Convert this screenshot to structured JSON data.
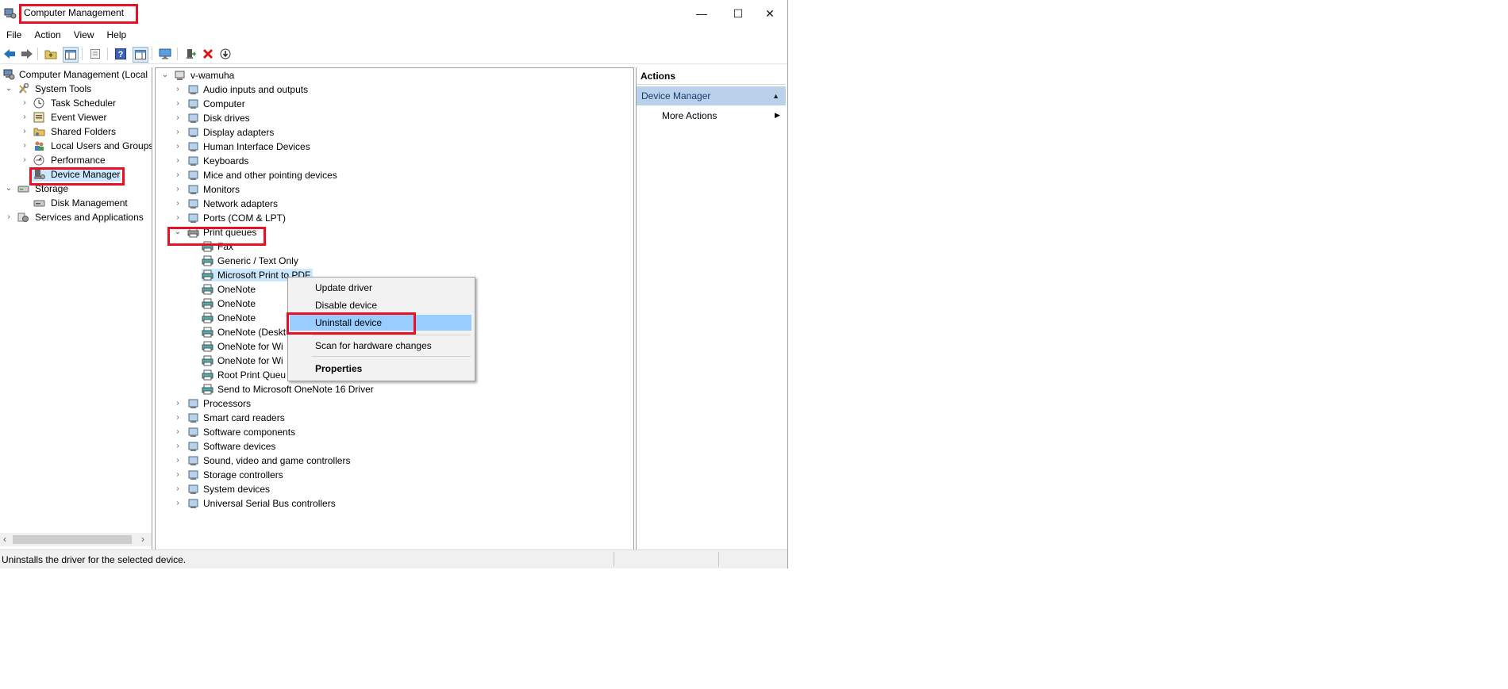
{
  "window": {
    "title": "Computer Management",
    "controls": {
      "minimize": "—",
      "maximize": "☐",
      "close": "✕"
    }
  },
  "menubar": [
    "File",
    "Action",
    "View",
    "Help"
  ],
  "toolbar": {
    "icons": [
      "back-icon",
      "forward-icon",
      "up-folder-icon",
      "show-hide-tree-icon",
      "properties-icon",
      "help-icon",
      "show-hide-action-pane-icon",
      "monitor-icon",
      "update-driver-icon",
      "uninstall-icon",
      "scan-hardware-icon"
    ]
  },
  "left_tree": {
    "root": "Computer Management (Local",
    "items": [
      {
        "label": "System Tools",
        "expander": "⌄"
      },
      {
        "label": "Task Scheduler",
        "expander": "›"
      },
      {
        "label": "Event Viewer",
        "expander": "›"
      },
      {
        "label": "Shared Folders",
        "expander": "›"
      },
      {
        "label": "Local Users and Groups",
        "expander": "›"
      },
      {
        "label": "Performance",
        "expander": "›"
      },
      {
        "label": "Device Manager",
        "expander": ""
      },
      {
        "label": "Storage",
        "expander": "⌄"
      },
      {
        "label": "Disk Management",
        "expander": ""
      },
      {
        "label": "Services and Applications",
        "expander": "›"
      }
    ],
    "scroll_left": "‹",
    "scroll_right": "›"
  },
  "device_tree": {
    "root": "v-wamuha",
    "categories_before": [
      "Audio inputs and outputs",
      "Computer",
      "Disk drives",
      "Display adapters",
      "Human Interface Devices",
      "Keyboards",
      "Mice and other pointing devices",
      "Monitors",
      "Network adapters",
      "Ports (COM & LPT)"
    ],
    "expanded_category": "Print queues",
    "print_queue_items": [
      "Fax",
      "Generic / Text Only",
      "Microsoft Print to PDF",
      "OneNote",
      "OneNote",
      "OneNote",
      "OneNote (Desktop)",
      "OneNote for Windows 10",
      "OneNote for Windows 10",
      "Root Print Queue",
      "Send to Microsoft OneNote 16 Driver"
    ],
    "categories_after": [
      "Processors",
      "Smart card readers",
      "Software components",
      "Software devices",
      "Sound, video and game controllers",
      "Storage controllers",
      "System devices",
      "Universal Serial Bus controllers"
    ],
    "visible_labels": [
      "Fax",
      "Generic / Text Only",
      "Microsoft Print to PDF",
      "OneNote",
      "OneNote",
      "OneNote",
      "OneNote (Deskt",
      "OneNote for Wi",
      "OneNote for Wi",
      "Root Print Queu",
      "Send to Microsoft OneNote 16 Driver"
    ]
  },
  "context_menu": {
    "items": [
      "Update driver",
      "Disable device",
      "Uninstall device",
      "Scan for hardware changes",
      "Properties"
    ],
    "highlighted": "Uninstall device"
  },
  "actions_pane": {
    "header": "Actions",
    "section": "Device Manager",
    "section_arrow": "▲",
    "more": "More Actions",
    "more_arrow": "▶"
  },
  "status_bar": {
    "text": "Uninstalls the driver for the selected device."
  },
  "colors": {
    "highlight_red": "#e81123",
    "menu_highlight": "#99ccff",
    "actions_section": "#b9d1ea"
  }
}
